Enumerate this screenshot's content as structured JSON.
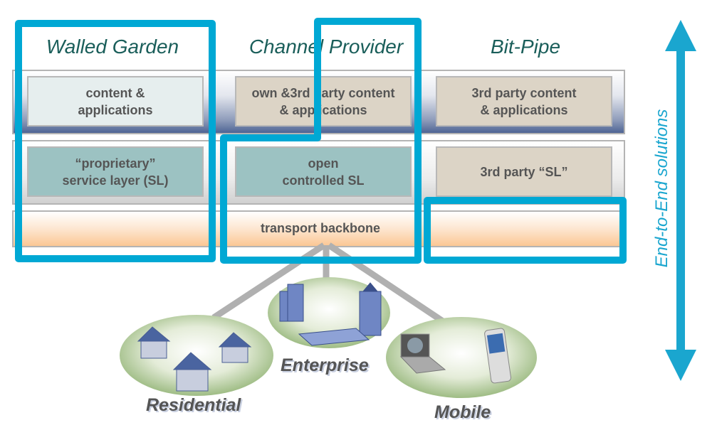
{
  "columns": [
    {
      "header": "Walled Garden",
      "content": "content &\napplications",
      "service_layer": "“proprietary”\nservice layer (SL)"
    },
    {
      "header": "Channel Provider",
      "content": "own &3rd party content\n& applications",
      "service_layer": "open\ncontrolled SL"
    },
    {
      "header": "Bit-Pipe",
      "content": "3rd party content\n& applications",
      "service_layer": "3rd party “SL”"
    }
  ],
  "transport": "transport backbone",
  "segments": {
    "residential": "Residential",
    "enterprise": "Enterprise",
    "mobile": "Mobile"
  },
  "axis_label": "End-to-End solutions",
  "colors": {
    "highlight": "#00a8d4",
    "header_text": "#1a5e5a",
    "arrow": "#1aa6cf"
  }
}
